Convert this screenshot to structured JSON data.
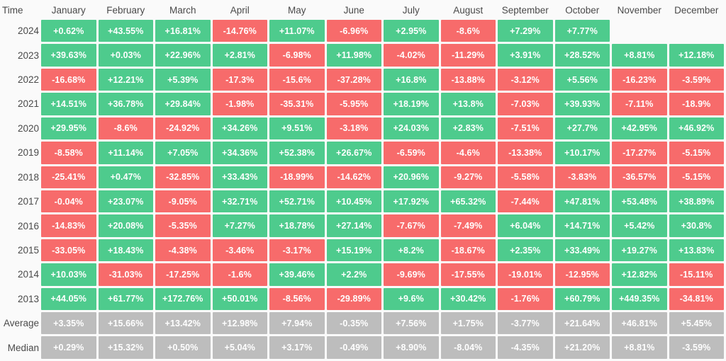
{
  "chart_data": {
    "type": "heatmap",
    "title": "",
    "xlabel": "",
    "ylabel": "Time",
    "grid": false,
    "legend": null,
    "corner_label": "Time",
    "categories": [
      "January",
      "February",
      "March",
      "April",
      "May",
      "June",
      "July",
      "August",
      "September",
      "October",
      "November",
      "December"
    ],
    "rows": [
      {
        "label": "2024",
        "kind": "year",
        "values": [
          "+0.62%",
          "+43.55%",
          "+16.81%",
          "-14.76%",
          "+11.07%",
          "-6.96%",
          "+2.95%",
          "-8.6%",
          "+7.29%",
          "+7.77%",
          "",
          ""
        ]
      },
      {
        "label": "2023",
        "kind": "year",
        "values": [
          "+39.63%",
          "+0.03%",
          "+22.96%",
          "+2.81%",
          "-6.98%",
          "+11.98%",
          "-4.02%",
          "-11.29%",
          "+3.91%",
          "+28.52%",
          "+8.81%",
          "+12.18%"
        ]
      },
      {
        "label": "2022",
        "kind": "year",
        "values": [
          "-16.68%",
          "+12.21%",
          "+5.39%",
          "-17.3%",
          "-15.6%",
          "-37.28%",
          "+16.8%",
          "-13.88%",
          "-3.12%",
          "+5.56%",
          "-16.23%",
          "-3.59%"
        ]
      },
      {
        "label": "2021",
        "kind": "year",
        "values": [
          "+14.51%",
          "+36.78%",
          "+29.84%",
          "-1.98%",
          "-35.31%",
          "-5.95%",
          "+18.19%",
          "+13.8%",
          "-7.03%",
          "+39.93%",
          "-7.11%",
          "-18.9%"
        ]
      },
      {
        "label": "2020",
        "kind": "year",
        "values": [
          "+29.95%",
          "-8.6%",
          "-24.92%",
          "+34.26%",
          "+9.51%",
          "-3.18%",
          "+24.03%",
          "+2.83%",
          "-7.51%",
          "+27.7%",
          "+42.95%",
          "+46.92%"
        ]
      },
      {
        "label": "2019",
        "kind": "year",
        "values": [
          "-8.58%",
          "+11.14%",
          "+7.05%",
          "+34.36%",
          "+52.38%",
          "+26.67%",
          "-6.59%",
          "-4.6%",
          "-13.38%",
          "+10.17%",
          "-17.27%",
          "-5.15%"
        ]
      },
      {
        "label": "2018",
        "kind": "year",
        "values": [
          "-25.41%",
          "+0.47%",
          "-32.85%",
          "+33.43%",
          "-18.99%",
          "-14.62%",
          "+20.96%",
          "-9.27%",
          "-5.58%",
          "-3.83%",
          "-36.57%",
          "-5.15%"
        ]
      },
      {
        "label": "2017",
        "kind": "year",
        "values": [
          "-0.04%",
          "+23.07%",
          "-9.05%",
          "+32.71%",
          "+52.71%",
          "+10.45%",
          "+17.92%",
          "+65.32%",
          "-7.44%",
          "+47.81%",
          "+53.48%",
          "+38.89%"
        ]
      },
      {
        "label": "2016",
        "kind": "year",
        "values": [
          "-14.83%",
          "+20.08%",
          "-5.35%",
          "+7.27%",
          "+18.78%",
          "+27.14%",
          "-7.67%",
          "-7.49%",
          "+6.04%",
          "+14.71%",
          "+5.42%",
          "+30.8%"
        ]
      },
      {
        "label": "2015",
        "kind": "year",
        "values": [
          "-33.05%",
          "+18.43%",
          "-4.38%",
          "-3.46%",
          "-3.17%",
          "+15.19%",
          "+8.2%",
          "-18.67%",
          "+2.35%",
          "+33.49%",
          "+19.27%",
          "+13.83%"
        ]
      },
      {
        "label": "2014",
        "kind": "year",
        "values": [
          "+10.03%",
          "-31.03%",
          "-17.25%",
          "-1.6%",
          "+39.46%",
          "+2.2%",
          "-9.69%",
          "-17.55%",
          "-19.01%",
          "-12.95%",
          "+12.82%",
          "-15.11%"
        ]
      },
      {
        "label": "2013",
        "kind": "year",
        "values": [
          "+44.05%",
          "+61.77%",
          "+172.76%",
          "+50.01%",
          "-8.56%",
          "-29.89%",
          "+9.6%",
          "+30.42%",
          "-1.76%",
          "+60.79%",
          "+449.35%",
          "-34.81%"
        ]
      },
      {
        "label": "Average",
        "kind": "stat",
        "values": [
          "+3.35%",
          "+15.66%",
          "+13.42%",
          "+12.98%",
          "+7.94%",
          "-0.35%",
          "+7.56%",
          "+1.75%",
          "-3.77%",
          "+21.64%",
          "+46.81%",
          "+5.45%"
        ]
      },
      {
        "label": "Median",
        "kind": "stat",
        "values": [
          "+0.29%",
          "+15.32%",
          "+0.50%",
          "+5.04%",
          "+3.17%",
          "-0.49%",
          "+8.90%",
          "-8.04%",
          "-4.35%",
          "+21.20%",
          "+8.81%",
          "-3.59%"
        ]
      }
    ],
    "colors": {
      "positive": "#4ecb8d",
      "negative": "#f76b6b",
      "stat": "#bdbdbd",
      "background": "#fafafa",
      "text": "#ffffff",
      "label_text": "#4a4a4a"
    }
  }
}
